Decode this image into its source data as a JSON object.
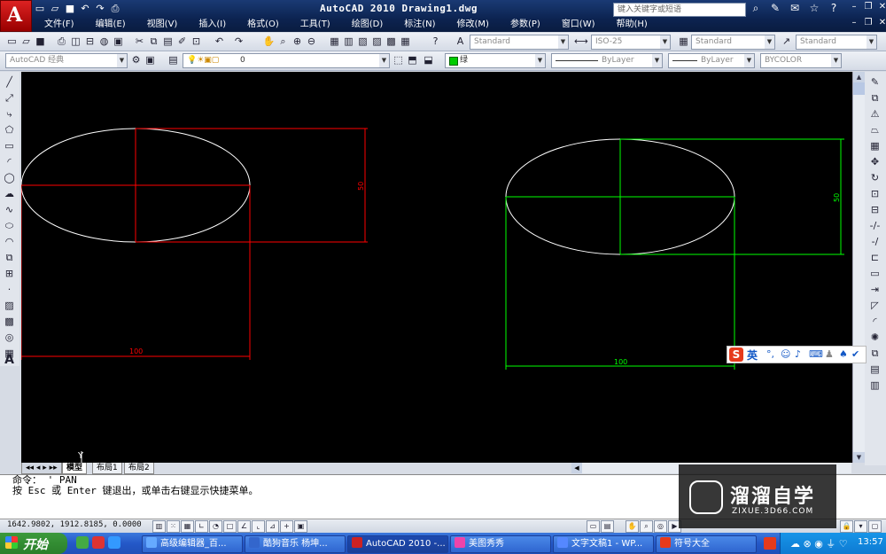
{
  "titlebar": {
    "logo_letter": "A",
    "title": "AutoCAD 2010  Drawing1.dwg",
    "search_placeholder": "键入关键字或短语",
    "qat_icons": [
      "new-icon",
      "open-icon",
      "save-icon",
      "undo-icon",
      "redo-icon",
      "print-icon"
    ]
  },
  "menubar": {
    "items": [
      "文件(F)",
      "编辑(E)",
      "视图(V)",
      "插入(I)",
      "格式(O)",
      "工具(T)",
      "绘图(D)",
      "标注(N)",
      "修改(M)",
      "参数(P)",
      "窗口(W)",
      "帮助(H)"
    ]
  },
  "toolbar2": {
    "text_style": "Standard",
    "dim_style": "ISO-25",
    "table_style": "Standard",
    "multileader_style": "Standard"
  },
  "toolbar3": {
    "workspace": "AutoCAD 经典",
    "layer": "0",
    "color": "绿",
    "linetype": "ByLayer",
    "lineweight": "ByLayer",
    "plotstyle": "BYCOLOR"
  },
  "drawing": {
    "left_dim_horizontal": "100",
    "left_dim_vertical": "50",
    "right_dim_horizontal": "100",
    "right_dim_vertical": "50",
    "ucs_label": "Y",
    "colors": {
      "red": "#ff0000",
      "green": "#00ff00",
      "white": "#ffffff"
    }
  },
  "tabs": [
    "模型",
    "布局1",
    "布局2"
  ],
  "command": {
    "line1": "命令： '_PAN",
    "line2": "按 Esc 或 Enter 键退出，或单击右键显示快捷菜单。"
  },
  "status": {
    "coords": "1642.9802, 1912.8185, 0.0000"
  },
  "ime": {
    "logo": "S",
    "mode": "英"
  },
  "watermark": {
    "title": "溜溜自学",
    "url": "ZIXUE.3D66.COM"
  },
  "taskbar": {
    "start": "开始",
    "tasks": [
      "高级编辑器_百...",
      "酷狗音乐 杨坤...",
      "AutoCAD 2010 -...",
      "美图秀秀",
      "文字文稿1 - WP...",
      "符号大全"
    ],
    "clock": "13:57"
  }
}
